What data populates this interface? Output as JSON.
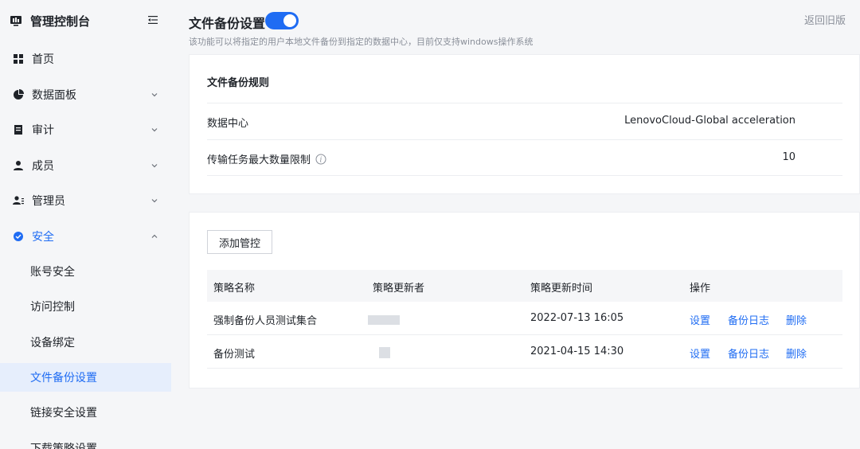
{
  "sidebar": {
    "brand_title": "管理控制台",
    "items": [
      {
        "label": "首页"
      },
      {
        "label": "数据面板"
      },
      {
        "label": "审计"
      },
      {
        "label": "成员"
      },
      {
        "label": "管理员"
      },
      {
        "label": "安全"
      }
    ],
    "security_children": [
      {
        "label": "账号安全"
      },
      {
        "label": "访问控制"
      },
      {
        "label": "设备绑定"
      },
      {
        "label": "文件备份设置"
      },
      {
        "label": "链接安全设置"
      },
      {
        "label": "下载策略设置"
      }
    ],
    "selected": "文件备份设置"
  },
  "header": {
    "title": "文件备份设置",
    "toggle_on": true,
    "description": "该功能可以将指定的用户本地文件备份到指定的数据中心，目前仅支持windows操作系统",
    "back_link": "返回旧版"
  },
  "rules": {
    "title": "文件备份规则",
    "rows": [
      {
        "label": "数据中心",
        "value": "LenovoCloud-Global acceleration"
      },
      {
        "label": "传输任务最大数量限制",
        "value": "10"
      }
    ]
  },
  "policies": {
    "add_button": "添加管控",
    "columns": [
      "策略名称",
      "策略更新者",
      "策略更新时间",
      "操作"
    ],
    "rows": [
      {
        "name": "强制备份人员测试集合",
        "updated_at": "2022-07-13 16:05",
        "actions": [
          "设置",
          "备份日志",
          "删除"
        ]
      },
      {
        "name": "备份测试",
        "updated_at": "2021-04-15 14:30",
        "actions": [
          "设置",
          "备份日志",
          "删除"
        ]
      }
    ]
  },
  "colors": {
    "accent": "#1f6cf3",
    "selected_bg": "#e6eefc",
    "page_bg": "#f5f6f8"
  }
}
